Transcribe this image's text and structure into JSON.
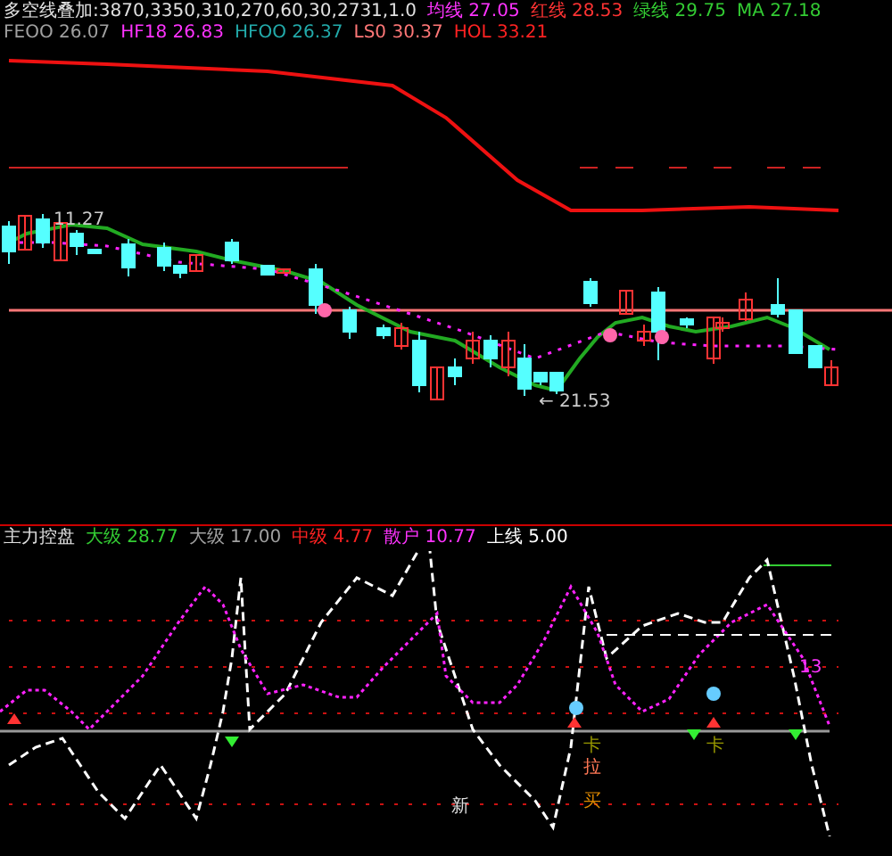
{
  "main_chart": {
    "legend": [
      {
        "text": "多空线叠加:3870,3350,310,270,60,30,2731,1.0",
        "color": "#e0e0e0"
      },
      {
        "text": "均线 27.05",
        "color": "#ff33ff"
      },
      {
        "text": "红线 28.53",
        "color": "#ff3333"
      },
      {
        "text": "绿线 29.75",
        "color": "#33cc33"
      },
      {
        "text": "MA 27.18",
        "color": "#33cc33"
      },
      {
        "text": "FEOO 26.07",
        "color": "#a0a0a0"
      },
      {
        "text": "HF18 26.83",
        "color": "#ff33ff"
      },
      {
        "text": "HFOO 26.37",
        "color": "#22aaaa"
      },
      {
        "text": "LS0 30.37",
        "color": "#ff7777"
      },
      {
        "text": "HOL 33.21",
        "color": "#ff2222"
      }
    ],
    "high_label": "11.27",
    "low_label": "← 21.53"
  },
  "indicator": {
    "legend": [
      {
        "text": "主力控盘",
        "color": "#e0e0e0"
      },
      {
        "text": "大级 28.77",
        "color": "#33cc33"
      },
      {
        "text": "大级 17.00",
        "color": "#a0a0a0"
      },
      {
        "text": "中级 4.77",
        "color": "#ff2222"
      },
      {
        "text": "散户 10.77",
        "color": "#ff33ff"
      },
      {
        "text": "上线 5.00",
        "color": "#ffffff"
      }
    ],
    "marks": [
      {
        "text": "13",
        "color": "#ff33ff"
      },
      {
        "text": "卡",
        "color": "#999900"
      },
      {
        "text": "拉",
        "color": "#ff7755"
      },
      {
        "text": "买",
        "color": "#dd8800"
      },
      {
        "text": "卡",
        "color": "#999900"
      },
      {
        "text": "新",
        "color": "#e0e0e0"
      }
    ]
  }
}
